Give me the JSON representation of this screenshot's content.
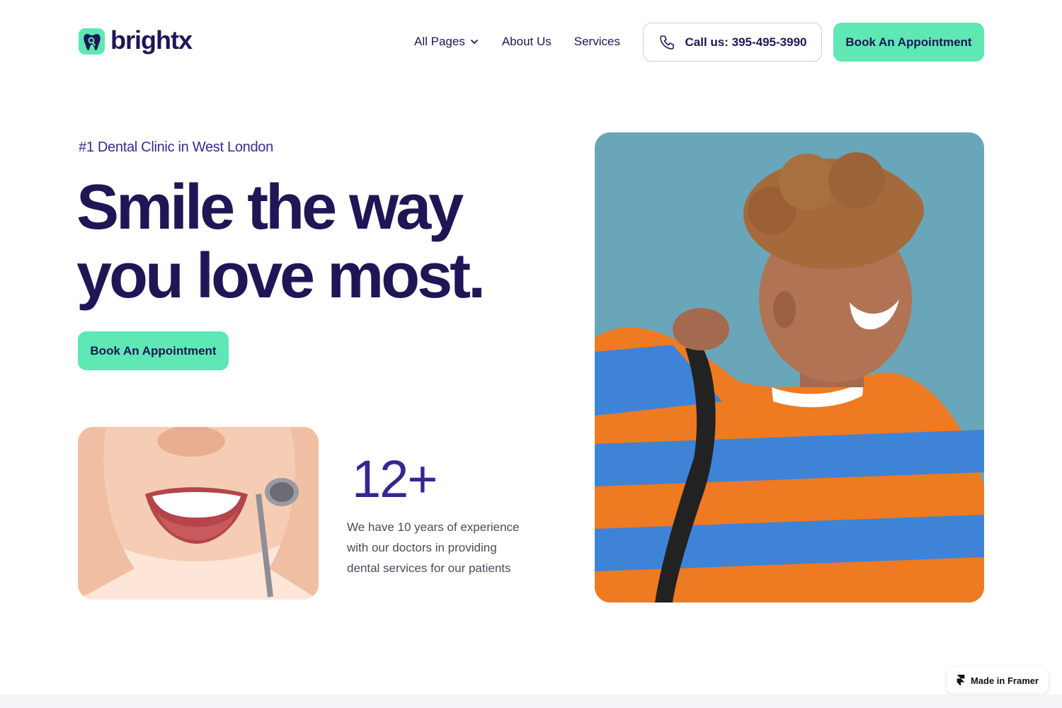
{
  "brand": {
    "name": "brightx",
    "accent": "#5fe8b4",
    "primary": "#1f1656"
  },
  "nav": {
    "items": [
      {
        "label": "All Pages",
        "has_dropdown": true
      },
      {
        "label": "About Us"
      },
      {
        "label": "Services"
      }
    ],
    "call_label": "Call us: 395-495-3990",
    "cta_label": "Book An Appointment"
  },
  "hero": {
    "eyebrow": "#1 Dental Clinic in West London",
    "headline_line1": "Smile the way",
    "headline_line2": "you love most.",
    "cta_label": "Book An Appointment",
    "stat_number": "12+",
    "stat_text": "We have 10 years of experience with our doctors in providing dental services for our patients"
  },
  "badge": {
    "label": "Made in Framer"
  },
  "icons": {
    "logo": "tooth-icon",
    "dropdown": "chevron-down-icon",
    "phone": "phone-icon",
    "framer": "framer-icon"
  }
}
